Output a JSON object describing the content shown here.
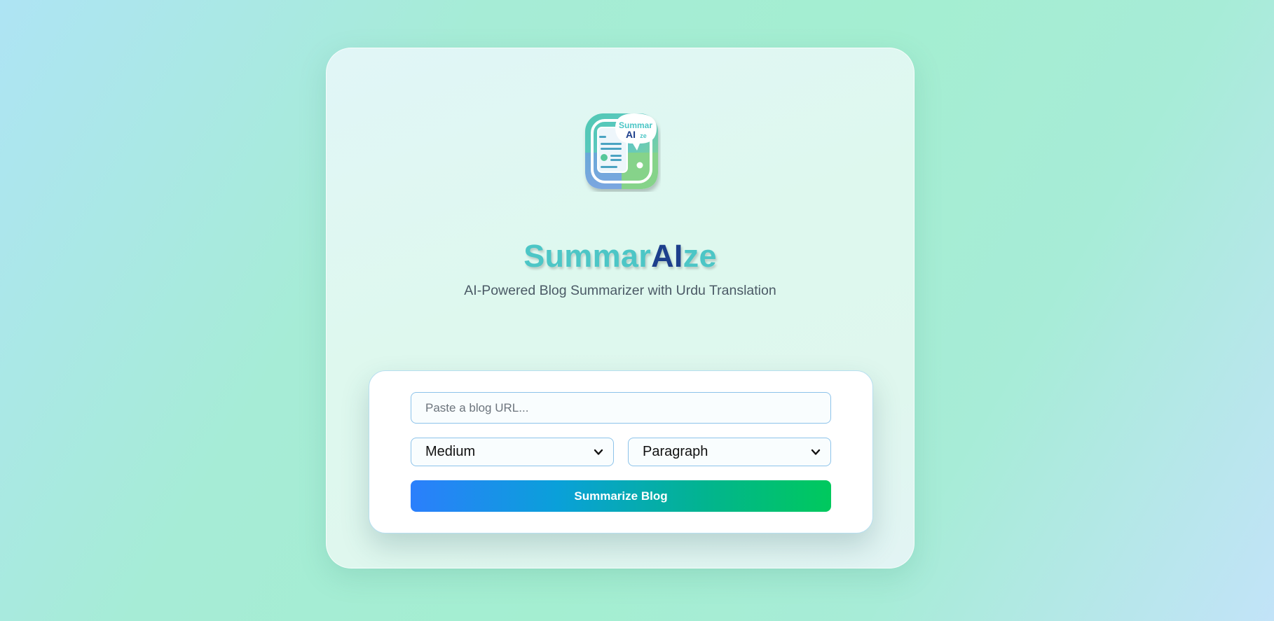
{
  "app": {
    "logo_badge_line1": "Summar",
    "logo_badge_line2_a": "AI",
    "logo_badge_line2_b": "ze",
    "title_part1": "Summar",
    "title_part2": "AI",
    "title_part3": "ze",
    "subtitle": "AI-Powered Blog Summarizer with Urdu Translation"
  },
  "form": {
    "url_placeholder": "Paste a blog URL...",
    "url_value": "",
    "length_selected": "Medium",
    "format_selected": "Paragraph",
    "submit_label": "Summarize Blog"
  },
  "colors": {
    "accent_teal": "#4cc6c6",
    "accent_navy": "#1d3f8c",
    "button_gradient_start": "#2b7ffc",
    "button_gradient_end": "#00c95d",
    "input_border": "#8dc3ea"
  },
  "icons": {
    "logo": "summaraize-app-icon",
    "select_chevron": "chevron-down-icon"
  }
}
